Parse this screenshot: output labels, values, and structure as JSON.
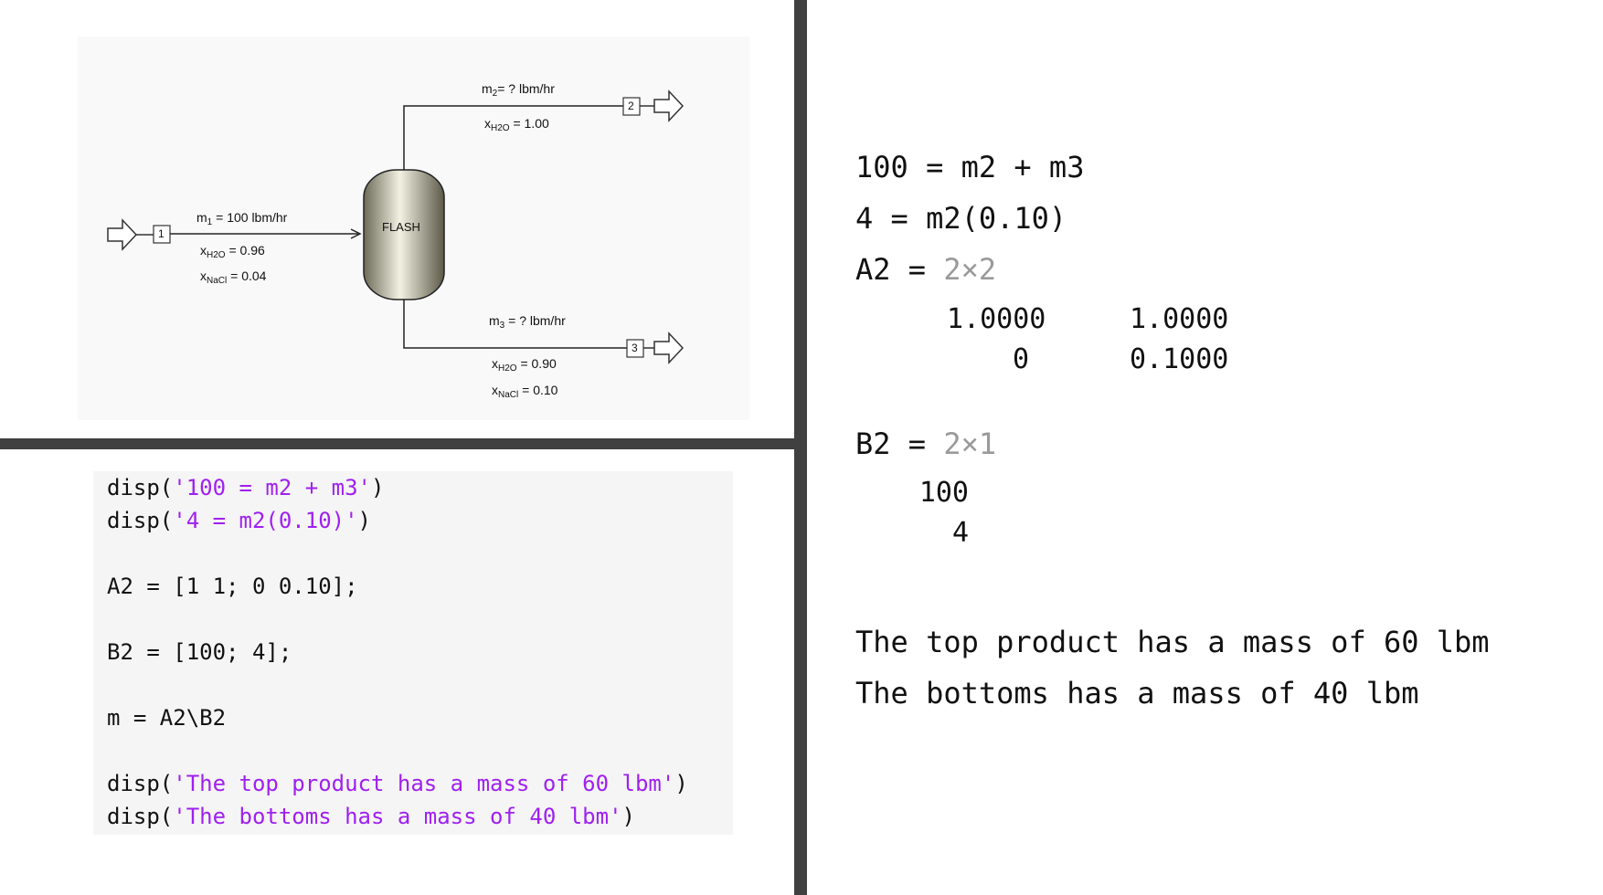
{
  "diagram": {
    "unit_label": "FLASH",
    "streams": [
      {
        "id": "1",
        "m_label": "m",
        "m_sub": "1",
        "m_value": " = 100 lbm/hr",
        "x1_pre": "x",
        "x1_sub": "H2O",
        "x1_val": " = 0.96",
        "x2_pre": "x",
        "x2_sub": "NaCl",
        "x2_val": " = 0.04"
      },
      {
        "id": "2",
        "m_label": "m",
        "m_sub": "2",
        "m_value": "= ? lbm/hr",
        "x1_pre": "x",
        "x1_sub": "H2O",
        "x1_val": " = 1.00"
      },
      {
        "id": "3",
        "m_label": "m",
        "m_sub": "3",
        "m_value": " = ? lbm/hr",
        "x1_pre": "x",
        "x1_sub": "H2O",
        "x1_val": " = 0.90",
        "x2_pre": "x",
        "x2_sub": "NaCl",
        "x2_val": " = 0.10"
      }
    ]
  },
  "code": {
    "l1_fn": "disp(",
    "l1_str": "'100 = m2 + m3'",
    "l1_end": ")",
    "l2_fn": "disp(",
    "l2_str": "'4 = m2(0.10)'",
    "l2_end": ")",
    "l3": "A2 = [1 1; 0 0.10];",
    "l4": "B2 = [100; 4];",
    "l5": "m = A2\\B2",
    "l6_fn": "disp(",
    "l6_str": "'The top product has a mass of 60 lbm'",
    "l6_end": ")",
    "l7_fn": "disp(",
    "l7_str": "'The bottoms has a mass of 40 lbm'",
    "l7_end": ")"
  },
  "output": {
    "line1": "100 = m2 + m3",
    "line2": "4 = m2(0.10)",
    "a2_name": "A2 = ",
    "a2_size": "2×2",
    "a2_r1c1": "1.0000",
    "a2_r1c2": "1.0000",
    "a2_r2c1": "0",
    "a2_r2c2": "0.1000",
    "b2_name": "B2 = ",
    "b2_size": "2×1",
    "b2_r1": "100",
    "b2_r2": "4",
    "msg1": "The top product has a mass of 60 lbm",
    "msg2": "The bottoms has a mass of 40 lbm"
  }
}
